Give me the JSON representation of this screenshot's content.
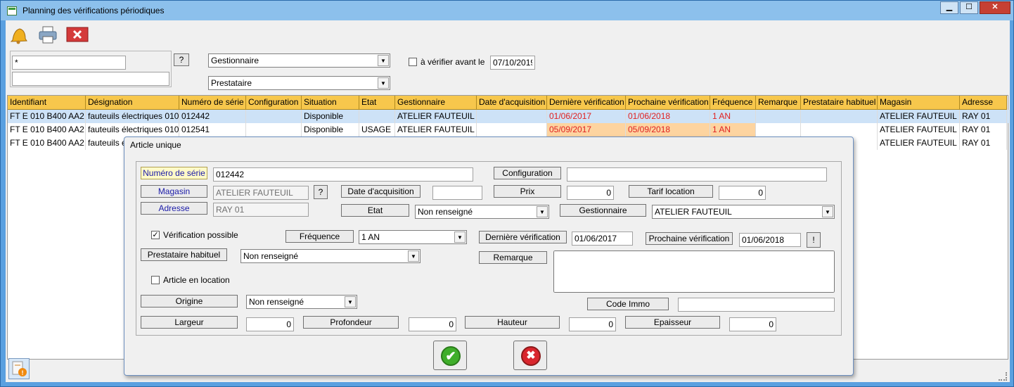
{
  "window": {
    "title": "Planning des vérifications périodiques",
    "minimize": "▁",
    "maximize": "☐",
    "close": "✕"
  },
  "filters": {
    "search1": "*",
    "search2": "",
    "help_btn": "?",
    "gestionnaire": "Gestionnaire",
    "prestataire": "Prestataire",
    "verify_before_label": "à vérifier avant le",
    "verify_before_date": "07/10/2019"
  },
  "grid": {
    "columns": [
      "Identifiant",
      "Désignation",
      "Numéro de série",
      "Configuration",
      "Situation",
      "Etat",
      "Gestionnaire",
      "Date d'acquisition",
      "Dernière vérification",
      "Prochaine vérification",
      "Fréquence",
      "Remarque",
      "Prestataire habituel",
      "Magasin",
      "Adresse"
    ],
    "rows": [
      [
        "FT E 010 B400 AA2",
        "fauteuils électriques 010",
        "012442",
        "",
        "Disponible",
        "",
        "ATELIER FAUTEUIL",
        "",
        "01/06/2017",
        "01/06/2018",
        "1 AN",
        "",
        "",
        "ATELIER FAUTEUIL",
        "RAY 01"
      ],
      [
        "FT E 010 B400 AA2",
        "fauteuils électriques 010",
        "012541",
        "",
        "Disponible",
        "USAGE",
        "ATELIER FAUTEUIL",
        "",
        "05/09/2017",
        "05/09/2018",
        "1 AN",
        "",
        "",
        "ATELIER FAUTEUIL",
        "RAY 01"
      ],
      [
        "FT E 010 B400 AA2",
        "fauteuils é",
        "",
        "",
        "",
        "",
        "",
        "",
        "",
        "",
        "",
        "",
        "",
        "ATELIER FAUTEUIL",
        "RAY 01"
      ]
    ]
  },
  "dialog": {
    "title": "Article unique",
    "numero_serie_label": "Numéro de série",
    "numero_serie": "012442",
    "configuration_label": "Configuration",
    "configuration": "",
    "magasin_label": "Magasin",
    "magasin": "ATELIER FAUTEUIL",
    "magasin_help": "?",
    "date_acq_label": "Date d'acquisition",
    "date_acq": "",
    "prix_label": "Prix",
    "prix": "0",
    "tarif_label": "Tarif location",
    "tarif": "0",
    "adresse_label": "Adresse",
    "adresse": "RAY 01",
    "etat_label": "Etat",
    "etat": "Non renseigné",
    "gestionnaire_label": "Gestionnaire",
    "gestionnaire": "ATELIER FAUTEUIL",
    "verif_possible_label": "Vérification possible",
    "frequence_label": "Fréquence",
    "frequence": "1 AN",
    "derniere_label": "Dernière vérification",
    "derniere": "01/06/2017",
    "prochaine_label": "Prochaine vérification",
    "prochaine": "01/06/2018",
    "excl_btn": "!",
    "prestataire_label": "Prestataire habituel",
    "prestataire": "Non renseigné",
    "remarque_label": "Remarque",
    "remarque": "",
    "location_label": "Article en location",
    "origine_label": "Origine",
    "origine": "Non renseigné",
    "code_immo_label": "Code Immo",
    "code_immo": "",
    "largeur_label": "Largeur",
    "largeur": "0",
    "profondeur_label": "Profondeur",
    "profondeur": "0",
    "hauteur_label": "Hauteur",
    "hauteur": "0",
    "epaisseur_label": "Epaisseur",
    "epaisseur": "0",
    "ok_glyph": "✔",
    "cancel_glyph": "✖"
  }
}
